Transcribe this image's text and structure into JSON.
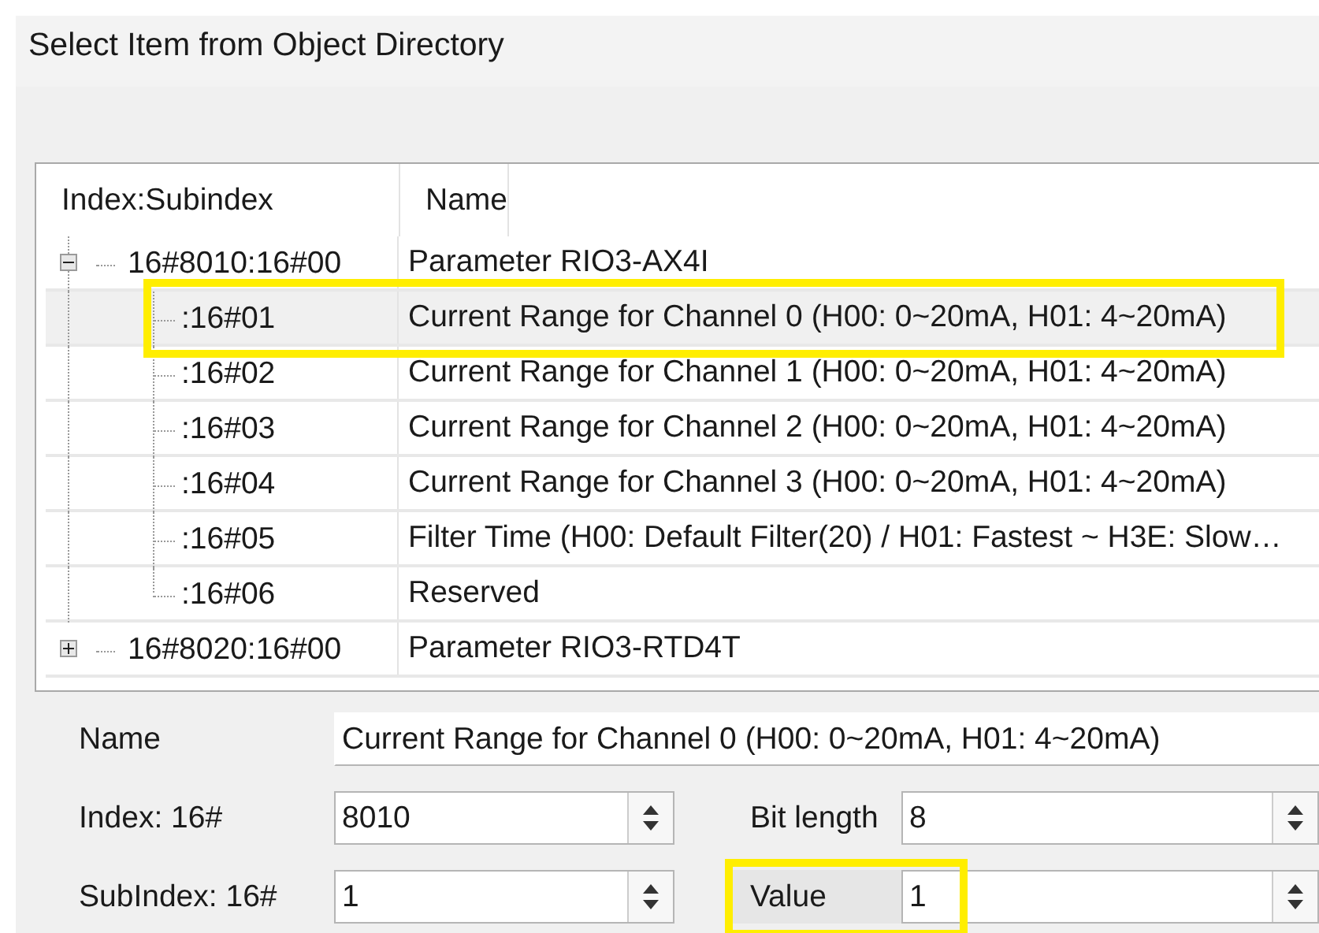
{
  "dialog": {
    "title": "Select Item from Object Directory"
  },
  "table": {
    "columns": [
      "Index:Subindex",
      "Name"
    ],
    "rows": [
      {
        "index": "16#8010:16#00",
        "name": "Parameter RIO3-AX4I",
        "expanded": true,
        "selected": false,
        "highlighted": false,
        "children": [
          {
            "index": ":16#01",
            "name": "Current Range for Channel 0 (H00: 0~20mA, H01: 4~20mA)",
            "selected": true,
            "highlighted": true
          },
          {
            "index": ":16#02",
            "name": "Current Range for Channel 1 (H00: 0~20mA, H01: 4~20mA)",
            "selected": false,
            "highlighted": false
          },
          {
            "index": ":16#03",
            "name": "Current Range for Channel 2 (H00: 0~20mA, H01: 4~20mA)",
            "selected": false,
            "highlighted": false
          },
          {
            "index": ":16#04",
            "name": "Current Range for Channel 3 (H00: 0~20mA, H01: 4~20mA)",
            "selected": false,
            "highlighted": false
          },
          {
            "index": ":16#05",
            "name": "Filter Time (H00: Default Filter(20) / H01: Fastest ~ H3E: Slow…",
            "selected": false,
            "highlighted": false
          },
          {
            "index": ":16#06",
            "name": "Reserved",
            "selected": false,
            "highlighted": false
          }
        ]
      },
      {
        "index": "16#8020:16#00",
        "name": "Parameter RIO3-RTD4T",
        "expanded": false,
        "selected": false,
        "highlighted": false,
        "children": []
      }
    ]
  },
  "form": {
    "name": {
      "label": "Name",
      "value": "Current Range for Channel 0 (H00: 0~20mA, H01: 4~20mA)"
    },
    "index": {
      "label": "Index:  16#",
      "value": "8010"
    },
    "bit_length": {
      "label": "Bit length",
      "value": "8"
    },
    "subindex": {
      "label": "SubIndex: 16#",
      "value": "1"
    },
    "value": {
      "label": "Value",
      "value": "1",
      "highlighted": true
    }
  }
}
